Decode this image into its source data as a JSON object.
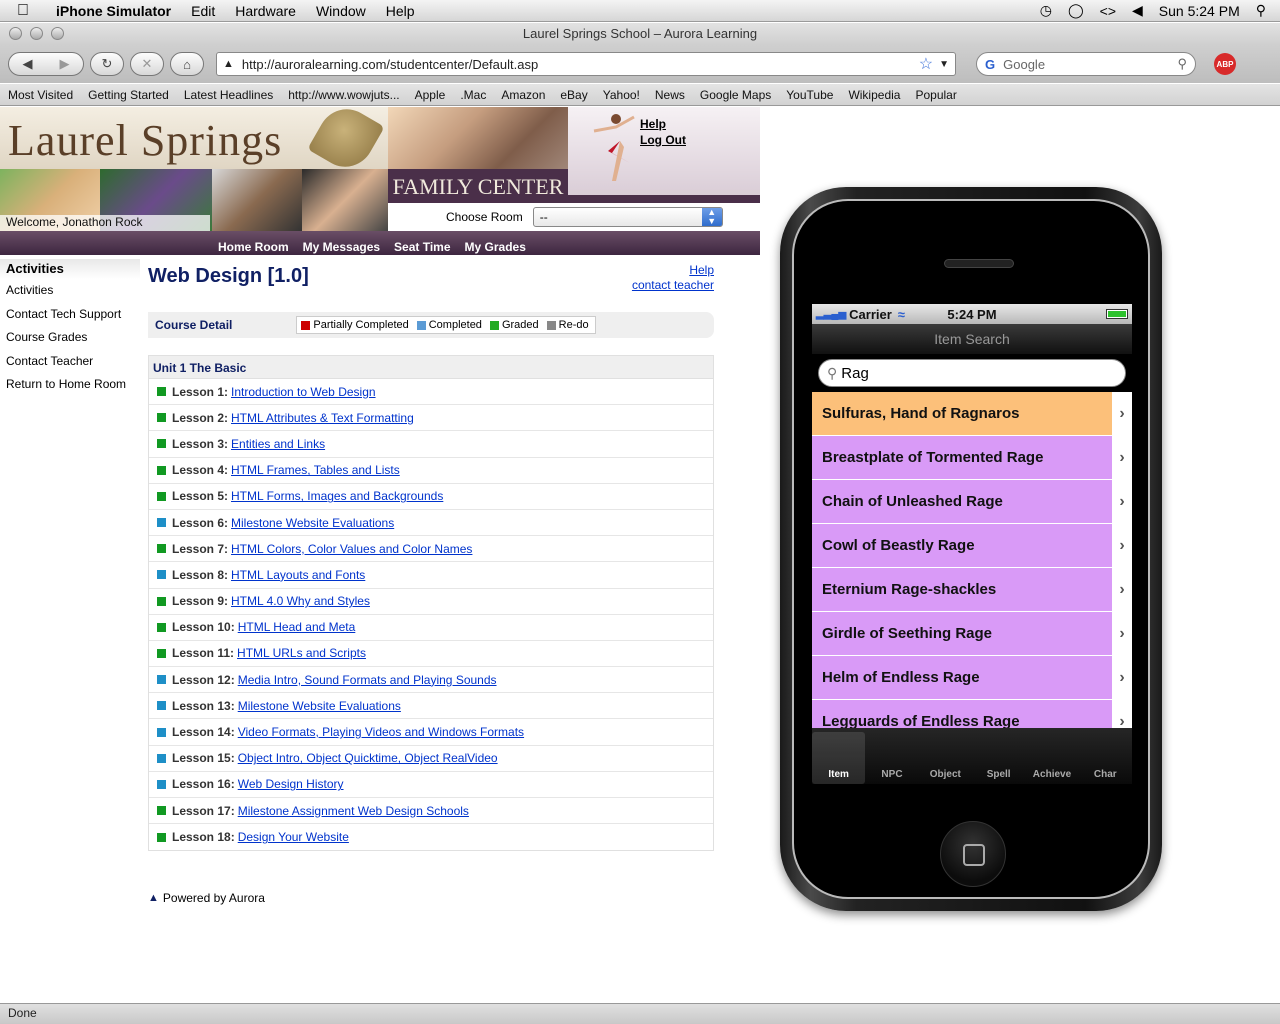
{
  "menubar": {
    "app": "iPhone Simulator",
    "items": [
      "Edit",
      "Hardware",
      "Window",
      "Help"
    ],
    "clock": "Sun 5:24 PM"
  },
  "window": {
    "title": "Laurel Springs School – Aurora Learning"
  },
  "toolbar": {
    "url": "http://auroralearning.com/studentcenter/Default.asp",
    "search_placeholder": "Google"
  },
  "bookmarks": [
    "Most Visited",
    "Getting Started",
    "Latest Headlines",
    "http://www.wowjuts...",
    "Apple",
    ".Mac",
    "Amazon",
    "eBay",
    "Yahoo!",
    "News",
    "Google Maps",
    "YouTube",
    "Wikipedia",
    "Popular"
  ],
  "banner": {
    "logo": "Laurel Springs",
    "family_center": "FAMILY CENTER",
    "help": "Help",
    "logout": "Log Out",
    "choose_room_label": "Choose Room",
    "choose_room_value": "--",
    "welcome": "Welcome, Jonathon Rock",
    "nav": [
      "Home Room",
      "My Messages",
      "Seat Time",
      "My Grades"
    ]
  },
  "sidebar": {
    "title": "Activities",
    "items": [
      "Activities",
      "Contact Tech Support",
      "Course Grades",
      "Contact Teacher",
      "Return to Home Room"
    ]
  },
  "main": {
    "title": "Web Design [1.0]",
    "help": "Help",
    "contact_teacher": "contact teacher",
    "course_detail": "Course Detail",
    "legend": [
      {
        "label": "Partially Completed",
        "color": "#cc0000"
      },
      {
        "label": "Completed",
        "color": "#5b9bd5"
      },
      {
        "label": "Graded",
        "color": "#22aa22"
      },
      {
        "label": "Re-do",
        "color": "#888888"
      }
    ],
    "unit": "Unit 1 The Basic",
    "lessons": [
      {
        "label": "Lesson 1:",
        "title": "Introduction to Web Design",
        "status": "#119922"
      },
      {
        "label": "Lesson 2:",
        "title": "HTML Attributes & Text Formatting",
        "status": "#119922"
      },
      {
        "label": "Lesson 3:",
        "title": "Entities and Links",
        "status": "#119922"
      },
      {
        "label": "Lesson 4:",
        "title": "HTML Frames, Tables and Lists",
        "status": "#119922"
      },
      {
        "label": "Lesson 5:",
        "title": "HTML Forms, Images and Backgrounds",
        "status": "#119922"
      },
      {
        "label": "Lesson 6:",
        "title": "Milestone Website Evaluations",
        "status": "#1e8fc7"
      },
      {
        "label": "Lesson 7:",
        "title": "HTML Colors, Color Values and Color Names",
        "status": "#119922"
      },
      {
        "label": "Lesson 8:",
        "title": "HTML Layouts and Fonts",
        "status": "#1e8fc7"
      },
      {
        "label": "Lesson 9:",
        "title": "HTML 4.0 Why and Styles",
        "status": "#119922"
      },
      {
        "label": "Lesson 10:",
        "title": "HTML Head and Meta",
        "status": "#119922"
      },
      {
        "label": "Lesson 11:",
        "title": "HTML URLs and Scripts",
        "status": "#119922"
      },
      {
        "label": "Lesson 12:",
        "title": "Media Intro, Sound Formats and Playing Sounds",
        "status": "#1e8fc7"
      },
      {
        "label": "Lesson 13:",
        "title": "Milestone Website Evaluations",
        "status": "#1e8fc7"
      },
      {
        "label": "Lesson 14:",
        "title": "Video Formats, Playing Videos and Windows Formats",
        "status": "#1e8fc7"
      },
      {
        "label": "Lesson 15:",
        "title": "Object Intro, Object Quicktime, Object RealVideo",
        "status": "#1e8fc7"
      },
      {
        "label": "Lesson 16:",
        "title": "Web Design History",
        "status": "#1e8fc7"
      },
      {
        "label": "Lesson 17:",
        "title": "Milestone Assignment Web Design Schools",
        "status": "#119922"
      },
      {
        "label": "Lesson 18:",
        "title": "Design Your Website",
        "status": "#119922"
      }
    ],
    "powered_by": "Powered by Aurora"
  },
  "iphone": {
    "carrier": "Carrier",
    "time": "5:24 PM",
    "nav_title": "Item Search",
    "search_value": "Rag",
    "results": [
      {
        "name": "Sulfuras, Hand of Ragnaros",
        "color": "#fcc07a"
      },
      {
        "name": "Breastplate of Tormented Rage",
        "color": "#d99af7"
      },
      {
        "name": "Chain of Unleashed Rage",
        "color": "#d99af7"
      },
      {
        "name": "Cowl of Beastly Rage",
        "color": "#d99af7"
      },
      {
        "name": "Eternium Rage-shackles",
        "color": "#d99af7"
      },
      {
        "name": "Girdle of Seething Rage",
        "color": "#d99af7"
      },
      {
        "name": "Helm of Endless Rage",
        "color": "#d99af7"
      },
      {
        "name": "Legguards of Endless Rage",
        "color": "#d99af7"
      }
    ],
    "tabs": [
      "Item",
      "NPC",
      "Object",
      "Spell",
      "Achieve",
      "Char"
    ],
    "active_tab": "Item"
  },
  "status": {
    "text": "Done"
  }
}
